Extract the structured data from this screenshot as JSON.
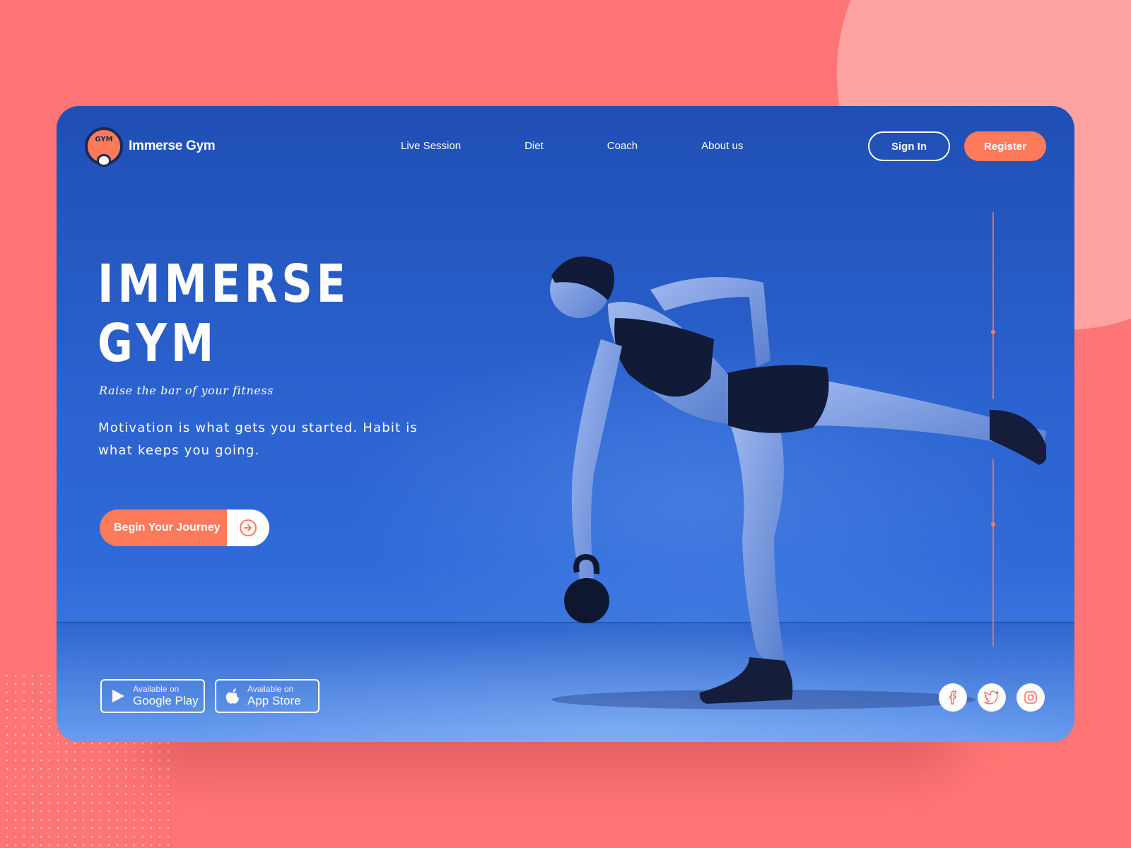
{
  "brand": {
    "name": "Immerse Gym",
    "logo_text": "GYM"
  },
  "nav": {
    "items": [
      {
        "label": "Live Session"
      },
      {
        "label": "Diet"
      },
      {
        "label": "Coach"
      },
      {
        "label": "About us"
      }
    ],
    "signin_label": "Sign In",
    "register_label": "Register"
  },
  "hero": {
    "title_line1": "IMMERSE",
    "title_line2": "GYM",
    "tagline": "Raise the bar of your fitness",
    "quote": "Motivation is what gets you started. Habit is what keeps you going.",
    "cta_label": "Begin Your Journey",
    "cta_icon": "arrow-right-circle-icon"
  },
  "stores": [
    {
      "small": "Available on",
      "big": "Google Play",
      "icon": "play-icon"
    },
    {
      "small": "Available on",
      "big": "App Store",
      "icon": "apple-icon"
    }
  ],
  "social": [
    {
      "icon": "facebook-icon"
    },
    {
      "icon": "twitter-icon"
    },
    {
      "icon": "instagram-icon"
    }
  ],
  "colors": {
    "background": "#ff7474",
    "blob": "#ffa2a2",
    "accent": "#ff7a5a",
    "hero_blue": "#2b62cf",
    "text": "#ffffff"
  }
}
